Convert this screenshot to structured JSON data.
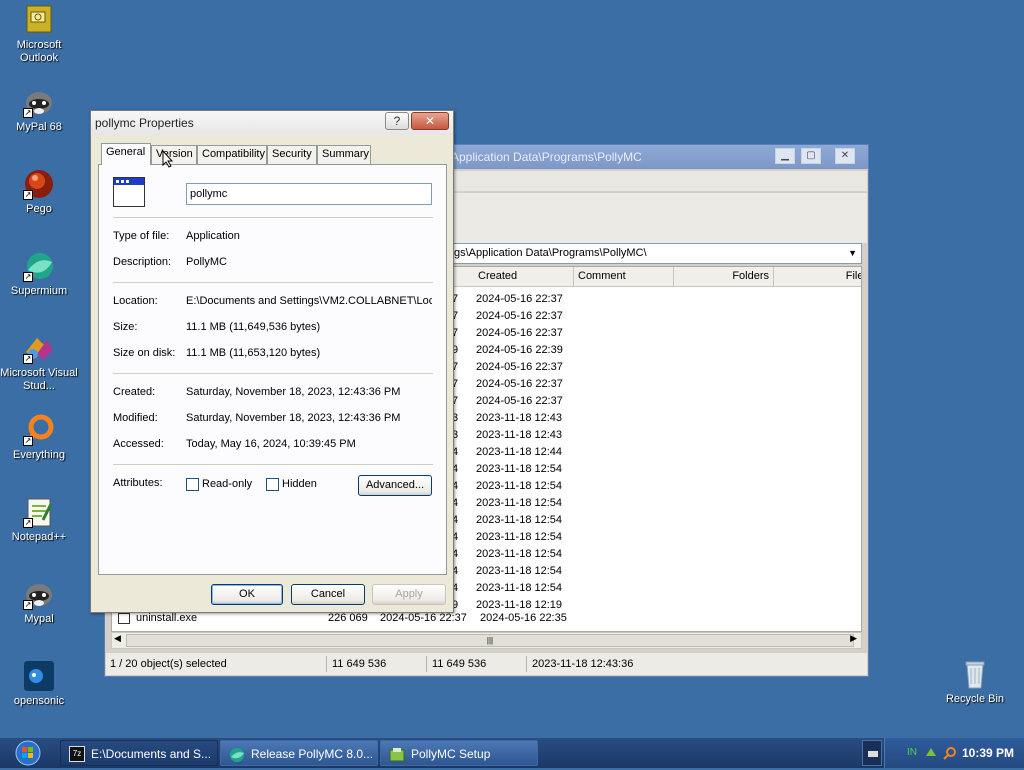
{
  "desktop": {
    "icons": [
      {
        "label": "Microsoft Outlook",
        "icon": "outlook-icon"
      },
      {
        "label": "MyPal 68",
        "icon": "mypal-icon"
      },
      {
        "label": "Pego",
        "icon": "pego-icon"
      },
      {
        "label": "Supermium",
        "icon": "supermium-icon"
      },
      {
        "label": "Microsoft Visual Stud...",
        "icon": "visual-studio-icon"
      },
      {
        "label": "Everything",
        "icon": "everything-icon"
      },
      {
        "label": "Notepad++",
        "icon": "notepadpp-icon"
      },
      {
        "label": "Mypal",
        "icon": "mypal-icon"
      },
      {
        "label": "opensonic",
        "icon": "opensonic-icon"
      },
      {
        "label": "Recycle Bin",
        "icon": "recycle-bin-icon"
      }
    ]
  },
  "file_manager": {
    "title": "Application Data\\Programs\\PollyMC",
    "path": "gs\\Application Data\\Programs\\PollyMC\\",
    "columns": [
      "Created",
      "Comment",
      "Folders",
      "Files"
    ],
    "rows": [
      {
        "mod": "7",
        "created": "2024-05-16 22:37"
      },
      {
        "mod": "7",
        "created": "2024-05-16 22:37"
      },
      {
        "mod": "7",
        "created": "2024-05-16 22:37"
      },
      {
        "mod": "9",
        "created": "2024-05-16 22:39"
      },
      {
        "mod": "7",
        "created": "2024-05-16 22:37"
      },
      {
        "mod": "7",
        "created": "2024-05-16 22:37"
      },
      {
        "mod": "7",
        "created": "2024-05-16 22:37"
      },
      {
        "mod": "3",
        "created": "2023-11-18 12:43"
      },
      {
        "mod": "3",
        "created": "2023-11-18 12:43"
      },
      {
        "mod": "4",
        "created": "2023-11-18 12:44"
      },
      {
        "mod": "4",
        "created": "2023-11-18 12:54"
      },
      {
        "mod": "4",
        "created": "2023-11-18 12:54"
      },
      {
        "mod": "4",
        "created": "2023-11-18 12:54"
      },
      {
        "mod": "4",
        "created": "2023-11-18 12:54"
      },
      {
        "mod": "4",
        "created": "2023-11-18 12:54"
      },
      {
        "mod": "4",
        "created": "2023-11-18 12:54"
      },
      {
        "mod": "4",
        "created": "2023-11-18 12:54"
      },
      {
        "mod": "4",
        "created": "2023-11-18 12:54"
      },
      {
        "mod": "9",
        "created": "2023-11-18 12:19"
      }
    ],
    "last_row": {
      "name": "uninstall.exe",
      "size": "226 069",
      "modified": "2024-05-16 22:37",
      "created": "2024-05-16 22:35"
    },
    "status": {
      "selected": "1 / 20 object(s) selected",
      "size": "11 649 536",
      "packed": "11 649 536",
      "date": "2023-11-18 12:43:36"
    },
    "hscroll_grip": "|||"
  },
  "dialog": {
    "title": "pollymc Properties",
    "help_label": "?",
    "close_label": "✕",
    "tabs": [
      "General",
      "Version",
      "Compatibility",
      "Security",
      "Summary"
    ],
    "name": "pollymc",
    "type_label": "Type of file:",
    "type_value": "Application",
    "desc_label": "Description:",
    "desc_value": "PollyMC",
    "location_label": "Location:",
    "location_value": "E:\\Documents and Settings\\VM2.COLLABNET\\Loc",
    "size_label": "Size:",
    "size_value": "11.1 MB (11,649,536 bytes)",
    "disk_label": "Size on disk:",
    "disk_value": "11.1 MB (11,653,120 bytes)",
    "created_label": "Created:",
    "created_value": "Saturday, November 18, 2023, 12:43:36 PM",
    "modified_label": "Modified:",
    "modified_value": "Saturday, November 18, 2023, 12:43:36 PM",
    "accessed_label": "Accessed:",
    "accessed_value": "Today, May 16, 2024, 10:39:45 PM",
    "attributes_label": "Attributes:",
    "readonly_label": "Read-only",
    "hidden_label": "Hidden",
    "advanced_label": "Advanced...",
    "ok_label": "OK",
    "cancel_label": "Cancel",
    "apply_label": "Apply"
  },
  "taskbar": {
    "buttons": [
      {
        "label": "E:\\Documents and S...",
        "icon": "7zip-icon"
      },
      {
        "label": "Release PollyMC 8.0...",
        "icon": "supermium-icon"
      },
      {
        "label": "PollyMC Setup",
        "icon": "setup-icon"
      }
    ],
    "tray_lang": "IN",
    "clock": "10:39 PM"
  }
}
